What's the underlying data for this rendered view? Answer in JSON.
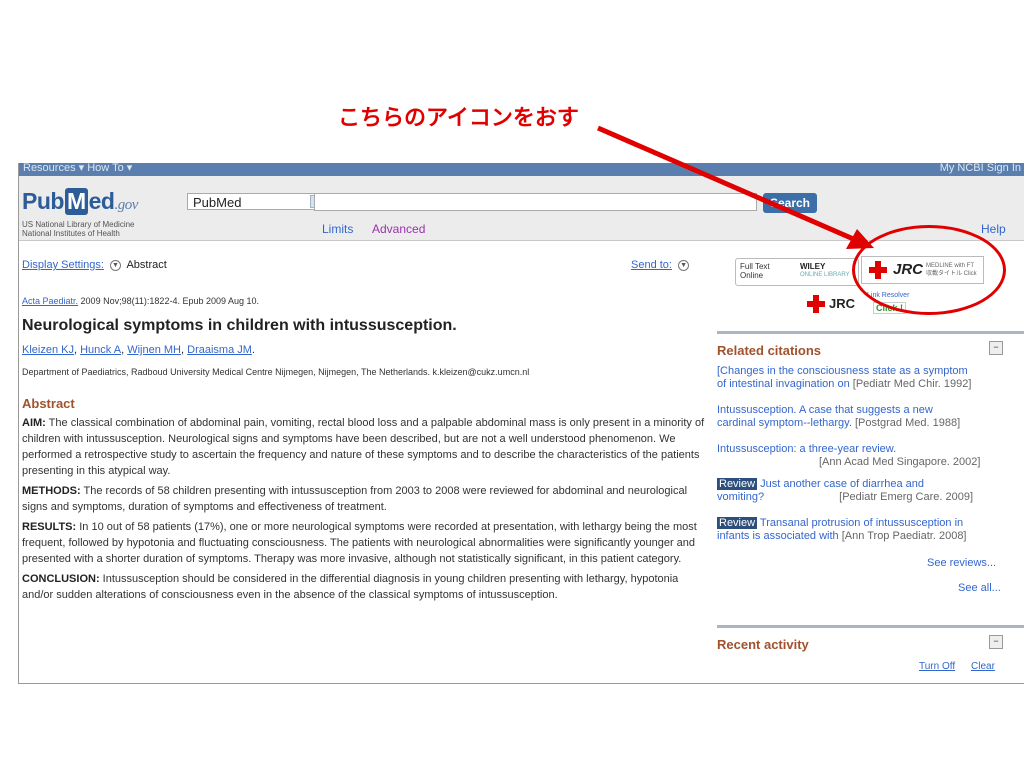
{
  "callout": {
    "text": "こちらのアイコンをおす"
  },
  "ncbi": {
    "left": "Resources ▾   How To ▾",
    "right": "My NCBI  Sign In"
  },
  "header": {
    "logo_pub": "Pub",
    "logo_m": "M",
    "logo_ed": "ed",
    "logo_gov": ".gov",
    "nlm_line1": "US National Library of Medicine",
    "nlm_line2": "National Institutes of Health",
    "db_selected": "PubMed",
    "search_value": "",
    "search_button": "Search",
    "limits": "Limits",
    "advanced": "Advanced",
    "help": "Help"
  },
  "toolbar": {
    "display_settings": "Display Settings:",
    "display_mode": "Abstract",
    "send_to": "Send to:"
  },
  "article": {
    "journal": "Acta Paediatr.",
    "citation": " 2009 Nov;98(11):1822-4. Epub 2009 Aug 10.",
    "title": "Neurological symptoms in children with intussusception.",
    "authors": [
      "Kleizen KJ",
      "Hunck A",
      "Wijnen MH",
      "Draaisma JM"
    ],
    "affiliation": "Department of Paediatrics, Radboud University Medical Centre Nijmegen, Nijmegen, The Netherlands. k.kleizen@cukz.umcn.nl",
    "abstract_heading": "Abstract",
    "aim_label": "AIM:",
    "aim": " The classical combination of abdominal pain, vomiting, rectal blood loss and a palpable abdominal mass is only present in a minority of children with intussusception. Neurological signs and symptoms have been described, but are not a well understood phenomenon. We performed a retrospective study to ascertain the frequency and nature of these symptoms and to describe the characteristics of the patients presenting in this atypical way.",
    "methods_label": "METHODS:",
    "methods": " The records of 58 children presenting with intussusception from 2003 to 2008 were reviewed for abdominal and neurological signs and symptoms, duration of symptoms and effectiveness of treatment.",
    "results_label": "RESULTS:",
    "results": " In 10 out of 58 patients (17%), one or more neurological symptoms were recorded at presentation, with lethargy being the most frequent, followed by hypotonia and fluctuating consciousness. The patients with neurological abnormalities were significantly younger and presented with a shorter duration of symptoms. Therapy was more invasive, although not statistically significant, in this patient category.",
    "conclusion_label": "CONCLUSION:",
    "conclusion": " Intussusception should be considered in the differential diagnosis in young children presenting with lethargy, hypotonia and/or sudden alterations of consciousness even in the absence of the classical symptoms of intussusception."
  },
  "linkout": {
    "fulltext_line1": "Full Text",
    "fulltext_line2": "Online",
    "wiley": "WILEY",
    "wiley_sub": "ONLINE LIBRARY",
    "jrc": "JRC",
    "jrc_small1": "MEDLINE with FT",
    "jrc_small2": "収載タイトル  Click",
    "jrc2": "JRC",
    "link_resolver": "Link Resolver",
    "click": "Click !"
  },
  "related": {
    "heading": "Related citations",
    "items": [
      {
        "line1": "[Changes in the consciousness state as a symptom",
        "line2": "of intestinal invagination on ",
        "journal": "[Pediatr Med Chir. 1992]"
      },
      {
        "line1": "Intussusception. A case that suggests a new",
        "line2": "cardinal symptom--lethargy. ",
        "journal": "[Postgrad Med. 1988]"
      },
      {
        "line1": "Intussusception: a three-year review.",
        "line2": "",
        "journal": "[Ann Acad Med Singapore. 2002]"
      },
      {
        "badge": "Review",
        "line1": " Just another case of diarrhea and",
        "line2": "vomiting? ",
        "journal": "[Pediatr Emerg Care. 2009]"
      },
      {
        "badge": "Review",
        "line1": " Transanal protrusion of intussusception in",
        "line2": "infants is associated with ",
        "journal": "[Ann Trop Paediatr. 2008]"
      }
    ],
    "see_reviews": "See reviews...",
    "see_all": "See all..."
  },
  "recent": {
    "heading": "Recent activity",
    "turn_off": "Turn Off",
    "clear": "Clear"
  },
  "colors": {
    "accent_red": "#e00000",
    "link": "#3366cc",
    "heading_brown": "#a0522d",
    "ncbi_bar": "#5a7fae"
  }
}
